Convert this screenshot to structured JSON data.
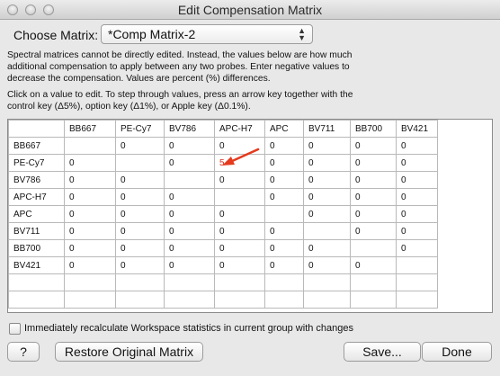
{
  "window": {
    "title": "Edit Compensation Matrix"
  },
  "choose": {
    "label": "Choose Matrix:",
    "value": "*Comp Matrix-2",
    "icon": "up-down-chevron-icon"
  },
  "info": {
    "p1": [
      "Spectral matrices cannot be directly edited.  Instead, the values below are how much",
      "additional compensation to apply between any two probes.  Enter negative values to",
      "decrease the compensation.  Values are percent (%) differences."
    ],
    "p2": [
      "Click on a value to edit. To step through values, press an arrow key together with the",
      "control key (Δ5%), option key (Δ1%), or Apple key (Δ0.1%)."
    ]
  },
  "matrix": {
    "columns": [
      "",
      "BB667",
      "PE-Cy7",
      "BV786",
      "APC-H7",
      "APC",
      "BV711",
      "BB700",
      "BV421"
    ],
    "rows": [
      [
        "BB667",
        "",
        "0",
        "0",
        "0",
        "0",
        "0",
        "0",
        "0"
      ],
      [
        "PE-Cy7",
        "0",
        "",
        "0",
        "5",
        "0",
        "0",
        "0",
        "0"
      ],
      [
        "BV786",
        "0",
        "0",
        "",
        "0",
        "0",
        "0",
        "0",
        "0"
      ],
      [
        "APC-H7",
        "0",
        "0",
        "0",
        "",
        "0",
        "0",
        "0",
        "0"
      ],
      [
        "APC",
        "0",
        "0",
        "0",
        "0",
        "",
        "0",
        "0",
        "0"
      ],
      [
        "BV711",
        "0",
        "0",
        "0",
        "0",
        "0",
        "",
        "0",
        "0"
      ],
      [
        "BB700",
        "0",
        "0",
        "0",
        "0",
        "0",
        "0",
        "",
        "0"
      ],
      [
        "BV421",
        "0",
        "0",
        "0",
        "0",
        "0",
        "0",
        "0",
        ""
      ]
    ],
    "edited_cell": {
      "row": 1,
      "col": 4
    },
    "edited_color": "#d62a1a",
    "arrow_color": "#e53a1e"
  },
  "footer": {
    "checkbox_label": "Immediately recalculate Workspace statistics in current group with changes",
    "checkbox_checked": false,
    "help_label": "?",
    "restore_label": "Restore Original Matrix",
    "save_label": "Save...",
    "done_label": "Done"
  }
}
